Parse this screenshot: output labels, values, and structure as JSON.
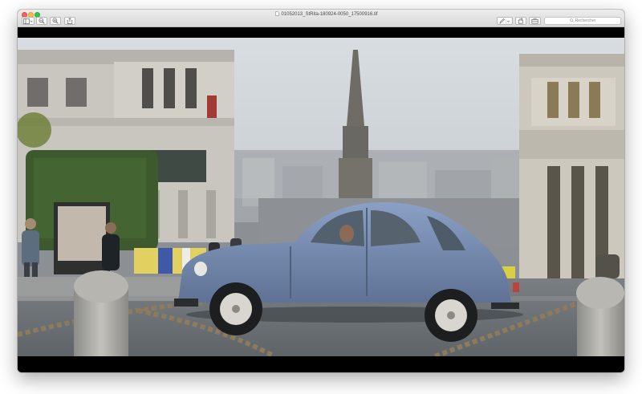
{
  "window": {
    "title": "01052013_StRita-180924-0050_17500916.tif"
  },
  "toolbar": {
    "sidebar_icon": "sidebar-icon",
    "zoom_out_icon": "zoom-out-icon",
    "zoom_in_icon": "zoom-in-icon",
    "share_icon": "share-icon",
    "markup_icon": "pen-icon",
    "rotate_icon": "rotate-icon",
    "toolbox_icon": "toolbox-icon"
  },
  "search": {
    "placeholder": "Rechercher"
  },
  "image": {
    "subject": "blue-citroen-2cv-photo"
  },
  "colors": {
    "close": "#fc605c",
    "minimize": "#fdbc40",
    "maximize": "#34c84a",
    "car_blue": "#7d93b8"
  }
}
